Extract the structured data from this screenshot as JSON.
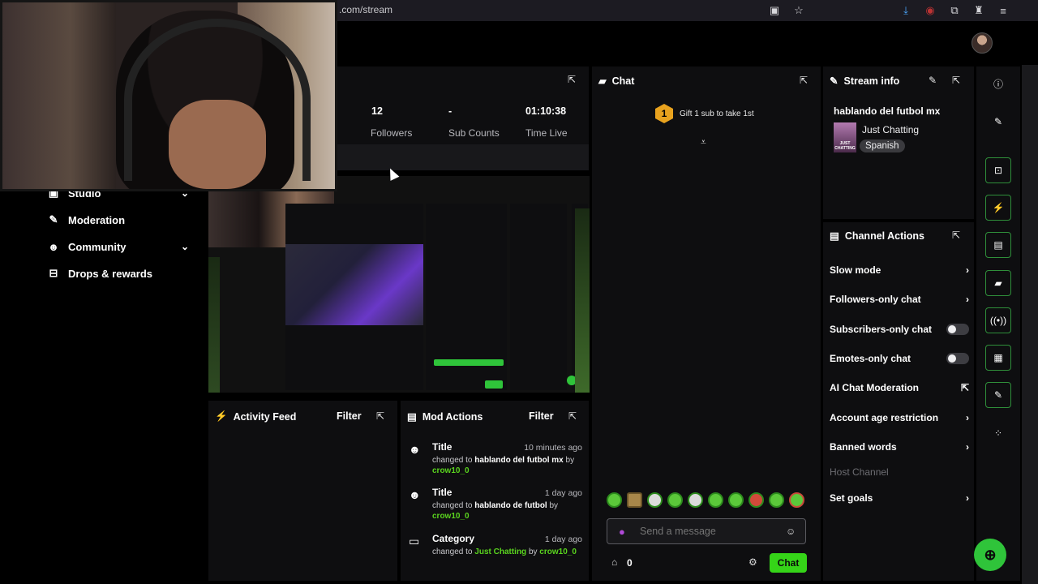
{
  "browser": {
    "url": ".com/stream",
    "icons": [
      "picture-in-picture-icon",
      "star-icon",
      "download-icon",
      "extension-icon",
      "puzzle-icon",
      "gift-icon",
      "menu-icon"
    ]
  },
  "nav": {
    "items": [
      {
        "label": "Studio",
        "icon": "video-icon",
        "has_chevron": true
      },
      {
        "label": "Moderation",
        "icon": "wrench-icon",
        "has_chevron": false
      },
      {
        "label": "Community",
        "icon": "people-icon",
        "has_chevron": true
      },
      {
        "label": "Drops & rewards",
        "icon": "drops-icon",
        "has_chevron": false
      }
    ]
  },
  "stats": {
    "followers_value": "12",
    "followers_label": "Followers",
    "subs_value": "-",
    "subs_label": "Sub Counts",
    "time_value": "01:10:38",
    "time_label": "Time Live"
  },
  "chat": {
    "title": "Chat",
    "gift_rank": "1",
    "gift_text": "Gift 1 sub to take 1st",
    "placeholder": "Send a message",
    "points": "0",
    "send_label": "Chat"
  },
  "stream_info": {
    "title": "Stream info",
    "stream_title": "hablando del futbol mx",
    "category": "Just Chatting",
    "language": "Spanish",
    "thumb_text": "JUST CHATTING"
  },
  "channel_actions": {
    "title": "Channel Actions",
    "items": [
      {
        "label": "Slow mode",
        "control": "chevron"
      },
      {
        "label": "Followers-only chat",
        "control": "chevron"
      },
      {
        "label": "Subscribers-only chat",
        "control": "toggle"
      },
      {
        "label": "Emotes-only chat",
        "control": "toggle"
      },
      {
        "label": "AI Chat Moderation",
        "control": "external"
      },
      {
        "label": "Account age restriction",
        "control": "chevron"
      },
      {
        "label": "Banned words",
        "control": "chevron"
      },
      {
        "label": "Host Channel",
        "control": "none"
      },
      {
        "label": "Set goals",
        "control": "chevron"
      }
    ]
  },
  "activity_feed": {
    "title": "Activity Feed",
    "filter_label": "Filter"
  },
  "mod_actions": {
    "title": "Mod Actions",
    "filter_label": "Filter",
    "entries": [
      {
        "type": "Title",
        "time": "10 minutes ago",
        "prefix": "changed to",
        "value": "hablando del futbol mx",
        "by": "by",
        "user": "crow10_0"
      },
      {
        "type": "Title",
        "time": "1 day ago",
        "prefix": "changed to",
        "value": "hablando de futbol",
        "by": "by",
        "user": "crow10_0"
      },
      {
        "type": "Category",
        "time": "1 day ago",
        "prefix": "changed to",
        "value": "Just Chatting",
        "by": "by",
        "user": "crow10_0"
      }
    ]
  },
  "colors": {
    "accent": "#35d418",
    "background": "#000000",
    "panel": "#0e0e10",
    "gift_coin": "#e8a21e"
  }
}
